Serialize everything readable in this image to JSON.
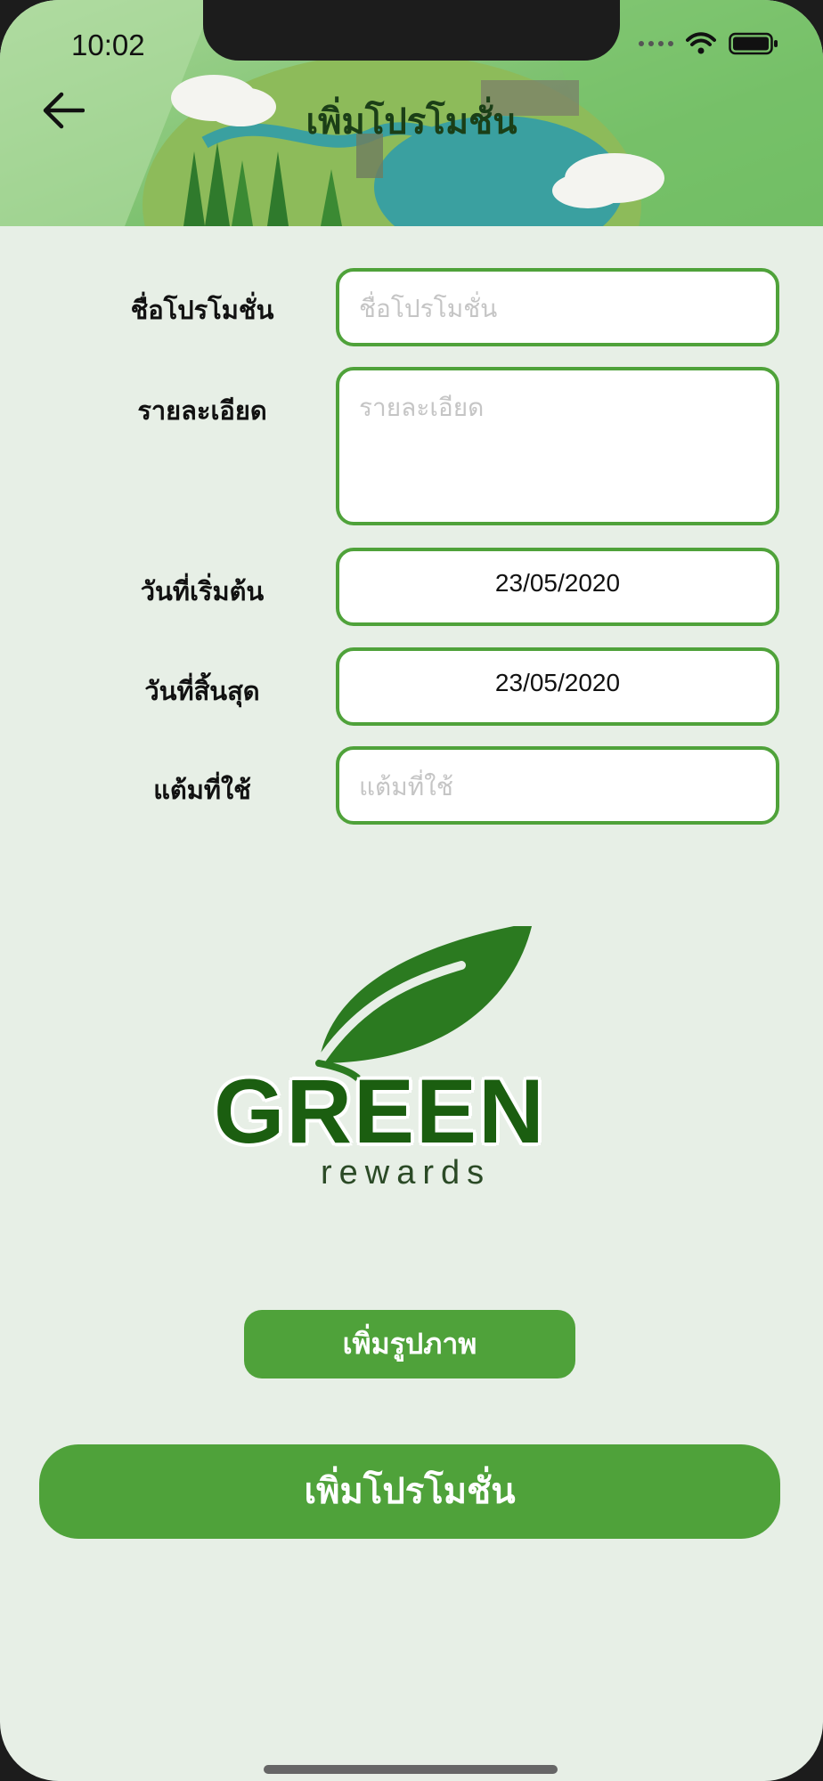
{
  "status_bar": {
    "time": "10:02"
  },
  "header": {
    "title": "เพิ่มโปรโมชั่น"
  },
  "form": {
    "name": {
      "label": "ชื่อโปรโมชั่น",
      "placeholder": "ชื่อโปรโมชั่น"
    },
    "details": {
      "label": "รายละเอียด",
      "placeholder": "รายละเอียด"
    },
    "start_date": {
      "label": "วันที่เริ่มต้น",
      "value": "23/05/2020"
    },
    "end_date": {
      "label": "วันที่สิ้นสุด",
      "value": "23/05/2020"
    },
    "points": {
      "label": "แต้มที่ใช้",
      "placeholder": "แต้มที่ใช้"
    }
  },
  "logo": {
    "title": "GREEN",
    "subtitle": "rewards"
  },
  "buttons": {
    "add_image": "เพิ่มรูปภาพ",
    "submit": "เพิ่มโปรโมชั่น"
  },
  "colors": {
    "accent": "#4fa23a",
    "background": "#e7efe6",
    "logo_dark": "#1b5e10"
  },
  "icons": {
    "back": "arrow-left-icon",
    "wifi": "wifi-icon",
    "battery": "battery-icon",
    "signal": "signal-dots-icon",
    "leaf": "leaf-icon"
  }
}
